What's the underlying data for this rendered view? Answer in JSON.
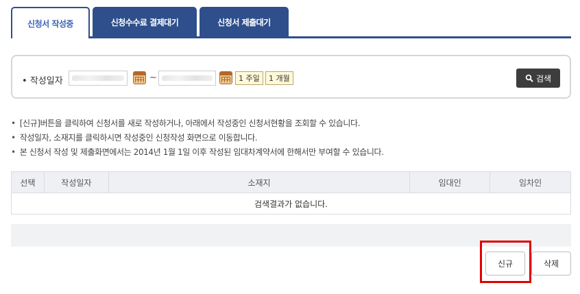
{
  "tabs": [
    {
      "label": "신청서 작성중"
    },
    {
      "label": "신청수수료 결제대기"
    },
    {
      "label": "신청서 제출대기"
    }
  ],
  "search": {
    "date_label": "작성일자",
    "range_sep": "~",
    "week_btn": "1 주일",
    "month_btn": "1 개월",
    "search_btn": "검색",
    "search_icon": "magnifier-icon",
    "calendar_icon": "calendar-icon"
  },
  "notes": [
    "[신규]버튼을 클릭하여 신청서를 새로 작성하거나, 아래에서 작성중인 신청서현황을 조회할 수 있습니다.",
    "작성일자, 소재지를 클릭하시면 작성중인 신청작성 화면으로 이동합니다.",
    "본 신청서 작성 및 제출화면에서는 2014년 1월 1일 이후 작성된 임대차계약서에 한해서만 부여할 수 있습니다."
  ],
  "table": {
    "headers": [
      "선택",
      "작성일자",
      "소재지",
      "임대인",
      "임차인"
    ],
    "empty_message": "검색결과가 없습니다."
  },
  "actions": {
    "new_label": "신규",
    "delete_label": "삭제"
  },
  "colors": {
    "tab_active_text": "#3a63b5",
    "tab_bg": "#2e4f8c",
    "highlight": "#e00000"
  }
}
